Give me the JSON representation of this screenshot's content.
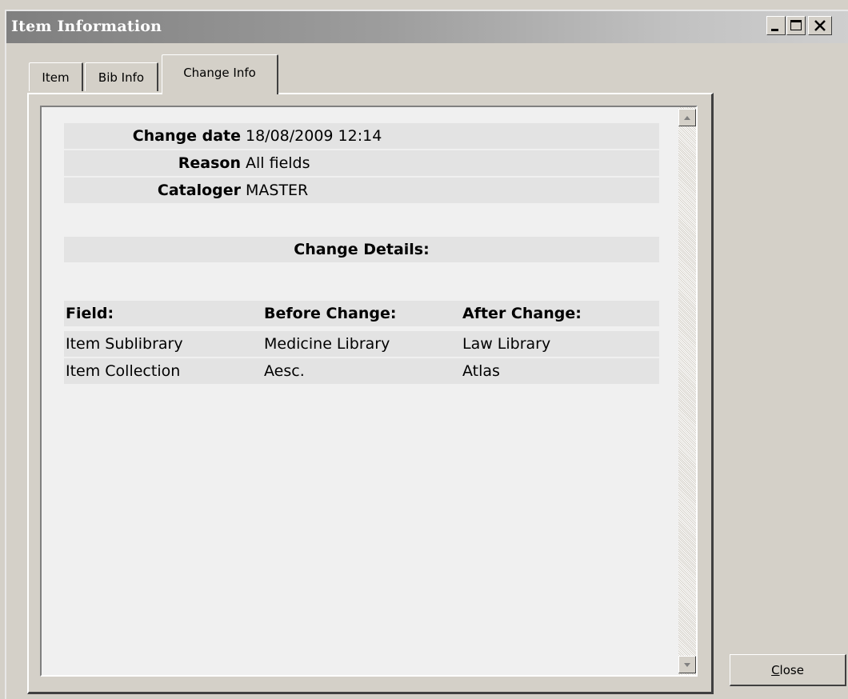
{
  "window": {
    "title": "Item Information"
  },
  "tabs": [
    {
      "label": "Item",
      "active": false
    },
    {
      "label": "Bib Info",
      "active": false
    },
    {
      "label": "Change Info",
      "active": true
    }
  ],
  "change_info": {
    "fields": [
      {
        "label": "Change date",
        "value": "18/08/2009 12:14"
      },
      {
        "label": "Reason",
        "value": "All fields"
      },
      {
        "label": "Cataloger",
        "value": "MASTER"
      }
    ],
    "details_heading": "Change Details:",
    "table": {
      "columns": [
        "Field:",
        "Before Change:",
        "After Change:"
      ],
      "rows": [
        [
          "Item Sublibrary",
          "Medicine Library",
          "Law Library"
        ],
        [
          "Item Collection",
          "Aesc.",
          "Atlas"
        ]
      ]
    }
  },
  "buttons": {
    "close_accel": "C",
    "close_rest": "lose"
  }
}
